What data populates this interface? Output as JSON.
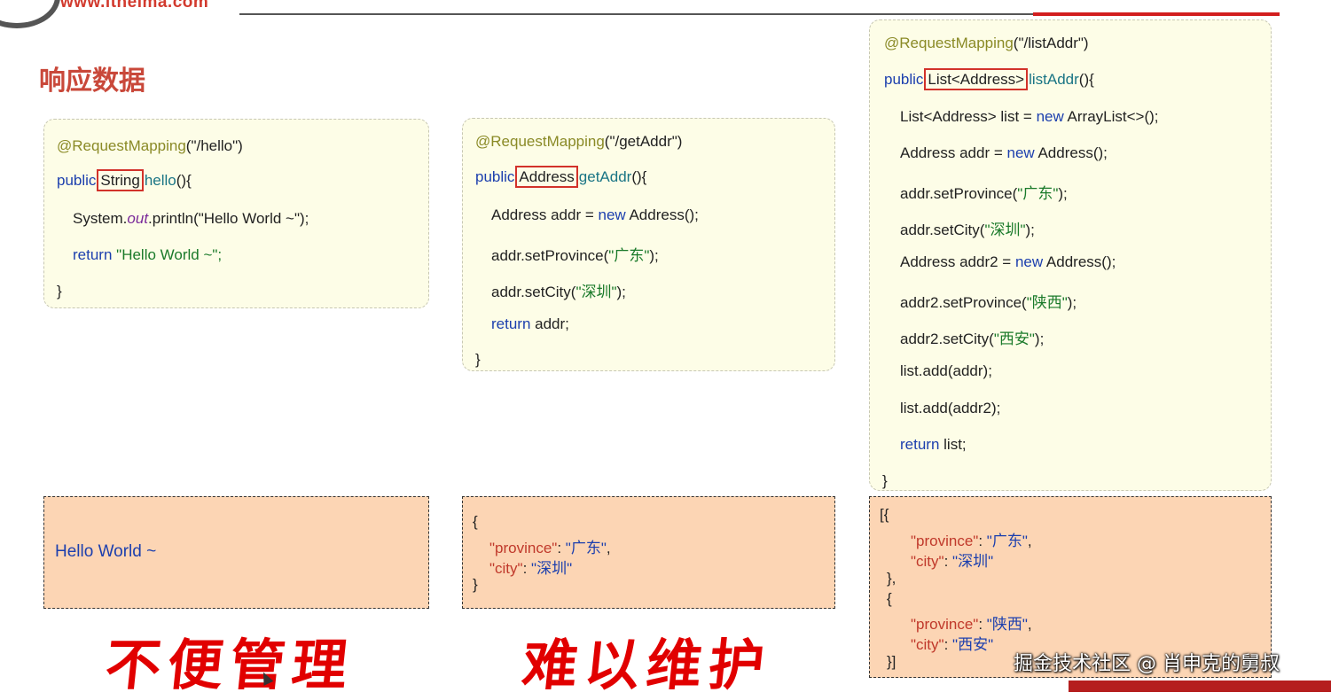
{
  "header": {
    "site_url": "www.itheima.com"
  },
  "title": "响应数据",
  "examples": {
    "hello": {
      "annotation": "@RequestMapping",
      "path": "(\"/hello\")",
      "public_kw": "public",
      "return_type": "String",
      "method_name": "hello",
      "method_sig_rest": "(){",
      "line_sys_prefix": "System.",
      "line_sys_out": "out",
      "line_sys_rest": ".println(\"Hello World ~\");",
      "return_kw": "return",
      "return_value": "\"Hello World ~\";",
      "close": "}"
    },
    "getAddr": {
      "annotation": "@RequestMapping",
      "path": "(\"/getAddr\")",
      "public_kw": "public",
      "return_type": "Address",
      "method_name": "getAddr",
      "method_sig_rest": "(){",
      "line1_pre": "Address addr = ",
      "line1_new": "new",
      "line1_post": " Address();",
      "line2_pre": "addr.setProvince(",
      "line2_str": "\"广东\"",
      "line2_post": ");",
      "line3_pre": "addr.setCity(",
      "line3_str": "\"深圳\"",
      "line3_post": ");",
      "return_kw": "return",
      "return_value": " addr;",
      "close": "}"
    },
    "listAddr": {
      "annotation": "@RequestMapping",
      "path": "(\"/listAddr\")",
      "public_kw": "public",
      "return_type": "List<Address>",
      "method_name": "listAddr",
      "method_sig_rest": "(){",
      "l1_pre": "List<Address> list = ",
      "l1_new": "new",
      "l1_post": " ArrayList<>();",
      "l2_pre": "Address addr = ",
      "l2_new": "new",
      "l2_post": " Address();",
      "l3_pre": "addr.setProvince(",
      "l3_str": "\"广东\"",
      "l3_post": ");",
      "l4_pre": "addr.setCity(",
      "l4_str": "\"深圳\"",
      "l4_post": ");",
      "l5_pre": "Address addr2 = ",
      "l5_new": "new",
      "l5_post": " Address();",
      "l6_pre": "addr2.setProvince(",
      "l6_str": "\"陕西\"",
      "l6_post": ");",
      "l7_pre": "addr2.setCity(",
      "l7_str": "\"西安\"",
      "l7_post": ");",
      "l8": "list.add(addr);",
      "l9": "list.add(addr2);",
      "return_kw": "return",
      "return_value": " list;",
      "close": "}"
    }
  },
  "responses": {
    "hello": "Hello World ~",
    "getAddr": {
      "open": "{",
      "k1": "\"province\"",
      "v1": "\"广东\"",
      "k2": "\"city\"",
      "v2": "\"深圳\"",
      "close": "}"
    },
    "listAddr": {
      "open": "[{",
      "k1": "\"province\"",
      "v1": "\"广东\"",
      "k2": "\"city\"",
      "v2": "\"深圳\"",
      "mid1": "},",
      "mid2": "{",
      "k3": "\"province\"",
      "v3": "\"陕西\"",
      "k4": "\"city\"",
      "v4": "\"西安\"",
      "close": "}]"
    }
  },
  "notes": {
    "left": "不便管理",
    "right": "难以维护"
  },
  "watermark": "掘金技术社区 @ 肖申克的舅叔"
}
